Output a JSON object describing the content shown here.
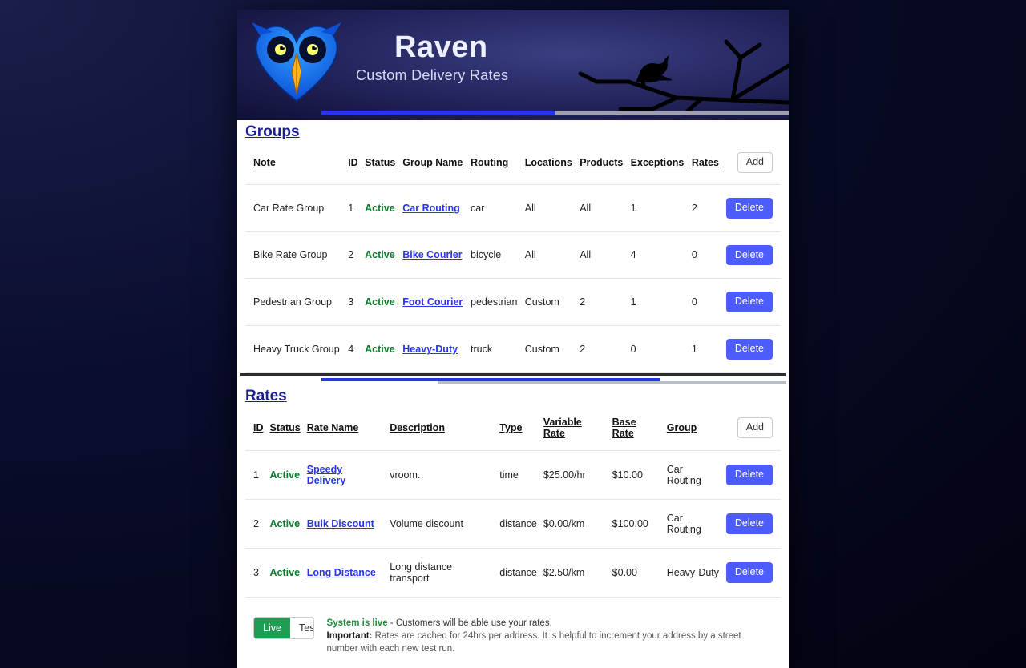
{
  "brand": {
    "title": "Raven",
    "subtitle": "Custom Delivery Rates"
  },
  "groups": {
    "title": "Groups",
    "add_label": "Add",
    "delete_label": "Delete",
    "columns": {
      "note": "Note",
      "id": "ID",
      "status": "Status",
      "group_name": "Group Name",
      "routing": "Routing",
      "locations": "Locations",
      "products": "Products",
      "exceptions": "Exceptions",
      "rates": "Rates"
    },
    "rows": [
      {
        "note": "Car Rate Group",
        "id": "1",
        "status": "Active",
        "group_name": "Car Routing",
        "routing": "car",
        "locations": "All",
        "products": "All",
        "exceptions": "1",
        "rates": "2"
      },
      {
        "note": "Bike Rate Group",
        "id": "2",
        "status": "Active",
        "group_name": "Bike Courier",
        "routing": "bicycle",
        "locations": "All",
        "products": "All",
        "exceptions": "4",
        "rates": "0"
      },
      {
        "note": "Pedestrian Group",
        "id": "3",
        "status": "Active",
        "group_name": "Foot Courier",
        "routing": "pedestrian",
        "locations": "Custom",
        "products": "2",
        "exceptions": "1",
        "rates": "0"
      },
      {
        "note": "Heavy Truck Group",
        "id": "4",
        "status": "Active",
        "group_name": "Heavy-Duty",
        "routing": "truck",
        "locations": "Custom",
        "products": "2",
        "exceptions": "0",
        "rates": "1"
      }
    ]
  },
  "rates": {
    "title": "Rates",
    "add_label": "Add",
    "delete_label": "Delete",
    "columns": {
      "id": "ID",
      "status": "Status",
      "rate_name": "Rate Name",
      "description": "Description",
      "type": "Type",
      "variable_rate": "Variable Rate",
      "base_rate": "Base Rate",
      "group": "Group"
    },
    "rows": [
      {
        "id": "1",
        "status": "Active",
        "rate_name": "Speedy Delivery",
        "description": "vroom.",
        "type": "time",
        "variable_rate": "$25.00/hr",
        "base_rate": "$10.00",
        "group": "Car Routing"
      },
      {
        "id": "2",
        "status": "Active",
        "rate_name": "Bulk Discount",
        "description": "Volume discount",
        "type": "distance",
        "variable_rate": "$0.00/km",
        "base_rate": "$100.00",
        "group": "Car Routing"
      },
      {
        "id": "3",
        "status": "Active",
        "rate_name": "Long Distance",
        "description": "Long distance transport",
        "type": "distance",
        "variable_rate": "$2.50/km",
        "base_rate": "$0.00",
        "group": "Heavy-Duty"
      }
    ]
  },
  "status": {
    "live_label": "Live",
    "test_label": "Test",
    "headline_bold": "System is live",
    "headline_rest": " - Customers will be able use your rates.",
    "note_bold": "Important:",
    "note_rest": " Rates are cached for 24hrs per address. It is helpful to increment your address by a street number with each new test run."
  }
}
